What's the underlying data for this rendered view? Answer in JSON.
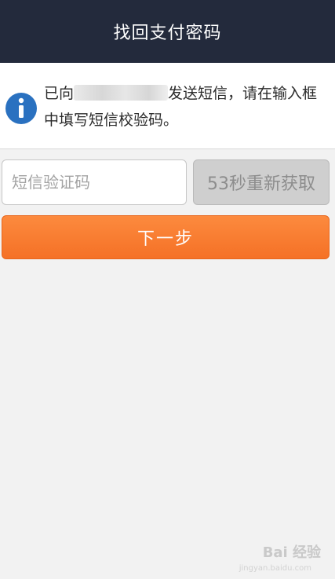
{
  "header": {
    "title": "找回支付密码"
  },
  "notice": {
    "icon": "info-icon",
    "text_before": "已向",
    "text_after": "发送短信，请在输入框中填写短信校验码。"
  },
  "form": {
    "code_placeholder": "短信验证码",
    "code_value": "",
    "resend_label": "53秒重新获取"
  },
  "actions": {
    "next_label": "下一步"
  },
  "watermark": {
    "brand": "Bai 经验",
    "url": "jingyan.baidu.com"
  },
  "colors": {
    "header_bg": "#232a3c",
    "info_blue": "#2a71c0",
    "primary_orange": "#f57126",
    "disabled_gray": "#cfcfcf"
  }
}
